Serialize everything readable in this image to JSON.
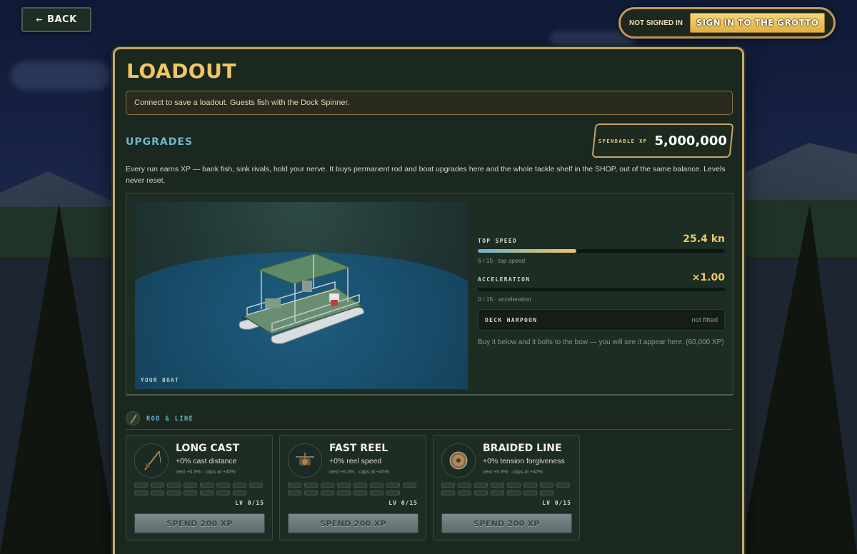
{
  "topbar": {
    "back_label": "BACK",
    "back_arrow": "←",
    "not_signed_in": "NOT SIGNED IN",
    "sign_in_label": "SIGN IN TO THE GROTTO"
  },
  "loadout": {
    "title": "LOADOUT",
    "notice": "Connect to save a loadout. Guests fish with the Dock Spinner.",
    "upgrades_heading": "UPGRADES",
    "spendable_xp_label": "SPENDABLE XP",
    "spendable_xp_value": "5,000,000",
    "description": "Every run earns XP — bank fish, sink rivals, hold your nerve. It buys permanent rod and boat upgrades here and the whole tackle shelf in the SHOP, out of the same balance. Levels never reset."
  },
  "boat": {
    "view_label": "YOUR BOAT",
    "stats": [
      {
        "label": "TOP SPEED",
        "value": "25.4 kn",
        "sub": "6 / 15 · top speed",
        "fill": 0.4
      },
      {
        "label": "ACCELERATION",
        "value": "×1.00",
        "sub": "0 / 15 · acceleration",
        "fill": 0
      }
    ],
    "harpoon_label": "DECK HARPOON",
    "harpoon_status": "not fitted",
    "harpoon_note": "Buy it below and it bolts to the bow — you will see it appear here. (60,000 XP)"
  },
  "rod_section": {
    "title": "ROD & LINE",
    "icon": "fishing-rod-icon"
  },
  "cards": [
    {
      "title": "LONG CAST",
      "effect": "+0% cast distance",
      "next": "next +6.3% · caps at +45%",
      "level": "LV 0/15",
      "button": "SPEND 200 XP",
      "icon": "fishing-rod-icon"
    },
    {
      "title": "FAST REEL",
      "effect": "+0% reel speed",
      "next": "next +6.3% · caps at +45%",
      "level": "LV 0/15",
      "button": "SPEND 200 XP",
      "icon": "reel-icon"
    },
    {
      "title": "BRAIDED LINE",
      "effect": "+0% tension forgiveness",
      "next": "next +5.8% · caps at +40%",
      "level": "LV 0/15",
      "button": "SPEND 200 XP",
      "icon": "line-spool-icon"
    }
  ],
  "colors": {
    "accent_gold": "#f1c564",
    "accent_blue": "#6eb7cf",
    "panel_border": "#c8a46a"
  }
}
